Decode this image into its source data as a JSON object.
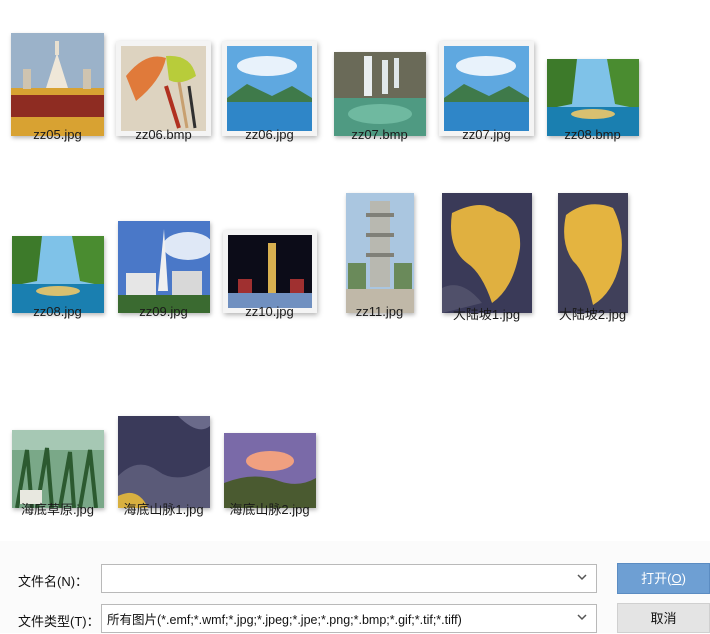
{
  "thumbnails": [
    {
      "name": "zz05.jpg",
      "icon": "jpg-image-thumbnail"
    },
    {
      "name": "zz06.bmp",
      "icon": "bmp-image-thumbnail"
    },
    {
      "name": "zz06.jpg",
      "icon": "jpg-image-thumbnail"
    },
    {
      "name": "zz07.bmp",
      "icon": "bmp-image-thumbnail"
    },
    {
      "name": "zz07.jpg",
      "icon": "jpg-image-thumbnail"
    },
    {
      "name": "zz08.bmp",
      "icon": "bmp-image-thumbnail"
    },
    {
      "name": "zz08.jpg",
      "icon": "jpg-image-thumbnail"
    },
    {
      "name": "zz09.jpg",
      "icon": "jpg-image-thumbnail"
    },
    {
      "name": "zz10.jpg",
      "icon": "jpg-image-thumbnail"
    },
    {
      "name": "zz11.jpg",
      "icon": "jpg-image-thumbnail"
    },
    {
      "name": "大陆坡1.jpg",
      "icon": "jpg-image-thumbnail"
    },
    {
      "name": "大陆坡2.jpg",
      "icon": "jpg-image-thumbnail"
    },
    {
      "name": "海底草原.jpg",
      "icon": "jpg-image-thumbnail"
    },
    {
      "name": "海底山脉1.jpg",
      "icon": "jpg-image-thumbnail"
    },
    {
      "name": "海底山脉2.jpg",
      "icon": "jpg-image-thumbnail"
    }
  ],
  "footer": {
    "filename_label": "文件名(N)：",
    "filename_value": "",
    "filetype_label": "文件类型(T)：",
    "filetype_value": "所有图片(*.emf;*.wmf;*.jpg;*.jpeg;*.jpe;*.png;*.bmp;*.gif;*.tif;*.tiff)",
    "open_label": "打开(",
    "open_key": "O",
    "open_label_end": ")",
    "cancel_label": "取消"
  },
  "colors": {
    "open_button_bg": "#6e9fd3",
    "cancel_button_bg": "#e4e4e4"
  }
}
